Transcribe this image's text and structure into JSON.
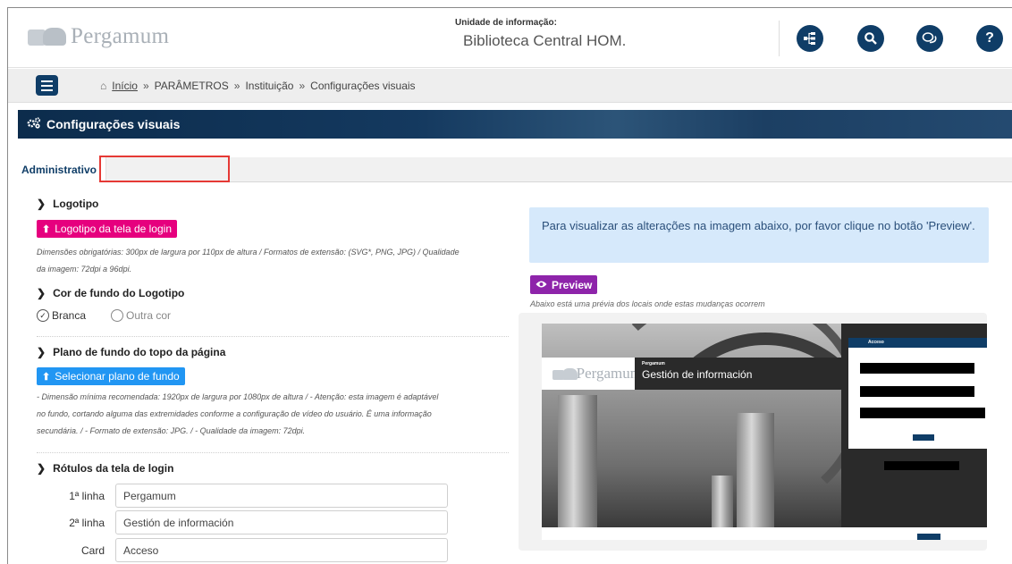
{
  "header": {
    "logo_text": "Pergamum",
    "unit_label": "Unidade de informação:",
    "unit_name": "Biblioteca Central HOM.",
    "icons": [
      "sitemap-icon",
      "search-icon",
      "chat-icon",
      "help-icon"
    ],
    "help_glyph": "?"
  },
  "breadcrumb": {
    "home": "Início",
    "items": [
      "PARÂMETROS",
      "Instituição",
      "Configurações visuais"
    ],
    "separator": "»"
  },
  "banner": {
    "title": "Configurações visuais"
  },
  "tabs": [
    {
      "label": "Administrativo"
    },
    {
      "label": ""
    }
  ],
  "left": {
    "logotipo": {
      "heading": "Logotipo",
      "button": "Logotipo da tela de login",
      "note_line1": "Dimensões obrigatórias: 300px de largura por 110px de altura / Formatos de extensão: (SVG*, PNG, JPG) / Qualidade",
      "note_line2": "da imagem: 72dpi a 96dpi."
    },
    "cor_fundo": {
      "heading": "Cor de fundo do Logotipo",
      "options": [
        "Branca",
        "Outra cor"
      ],
      "selected": "Branca"
    },
    "plano_fundo": {
      "heading": "Plano de fundo do topo da página",
      "button": "Selecionar plano de fundo",
      "note_line1": "- Dimensão mínima recomendada: 1920px de largura por 1080px de altura / - Atenção: esta imagem é adaptável",
      "note_line2": "no fundo, cortando alguma das extremidades conforme a configuração de vídeo do usuário. É uma informação",
      "note_line3": "secundária. / - Formato de extensão: JPG. / - Qualidade da imagem: 72dpi."
    },
    "rotulos": {
      "heading": "Rótulos da tela de login",
      "fields": [
        {
          "label": "1ª linha",
          "value": "Pergamum"
        },
        {
          "label": "2ª linha",
          "value": "Gestión de información"
        },
        {
          "label": "Card",
          "value": "Acceso"
        }
      ]
    }
  },
  "right": {
    "info": "Para visualizar as alterações na imagem abaixo, por favor clique no botão 'Preview'.",
    "preview_button": "Preview",
    "preview_note": "Abaixo está uma prévia dos locais onde estas mudanças ocorrem",
    "preview": {
      "logo_text": "Pergamum",
      "line1": "Pergamum",
      "line2": "Gestión de información",
      "card_title": "Acceso"
    }
  },
  "colors": {
    "brand_navy": "#0f3d67",
    "pink_button": "#e6007e",
    "blue_button": "#2196f3",
    "preview_button": "#8e24aa",
    "info_bg": "#d6e9fb",
    "highlight_red": "#e53935"
  }
}
